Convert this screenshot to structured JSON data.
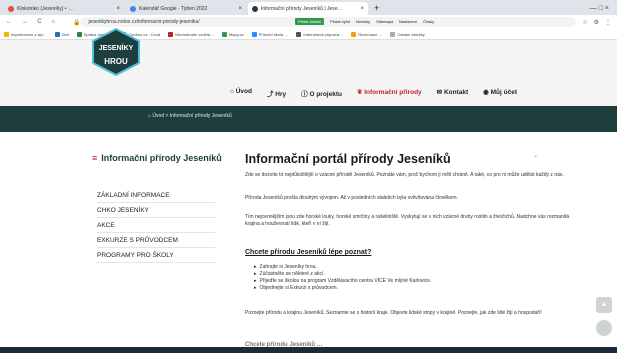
{
  "browser": {
    "tabs": [
      {
        "label": "Klokotoko (Jeseníky) • …",
        "color": "#e44f3a"
      },
      {
        "label": "Kalendář Google - Týden 2022",
        "color": "#4285f4"
      },
      {
        "label": "Informační přírody Jeseníků | Jese…",
        "color": "#1d3e3c"
      }
    ],
    "new_tab": "+",
    "window_controls": "—   □   ×",
    "nav_buttons": "← → C ⌂",
    "url": "jesenikyhrou.notoo.cz/informacni-prirody-jeseniku/",
    "bookmarks": [
      {
        "label": "Importováno z apl…",
        "color": "#f5b400"
      },
      {
        "label": "Dell",
        "color": "#2b6cb0"
      },
      {
        "label": "Správa Jeseníků",
        "color": "#3a7d44"
      },
      {
        "label": "Ozvěno.cz - Úvod",
        "color": "#888"
      },
      {
        "label": "Mezinárodní vzdělá…",
        "color": "#c0232a"
      },
      {
        "label": "Mapy.cz",
        "color": "#2e9a4a"
      },
      {
        "label": "Přírodní škola …",
        "color": "#1e90ff"
      },
      {
        "label": "Internetová příprava…",
        "color": "#555"
      },
      {
        "label": "Rezervace …",
        "color": "#f59e0b"
      },
      {
        "label": "Ostatní záložky",
        "color": "#aaa"
      }
    ]
  },
  "site": {
    "topstrip": [
      "Přidat článek",
      "Přidat výlet",
      "Novinky",
      "Sitemapa",
      "Nastavení",
      "Česky"
    ],
    "logo_top": "JESENÍKY",
    "logo_bottom": "HROU",
    "nav": [
      "Úvod",
      "Hry",
      "O projektu",
      "Informační přírody",
      "Kontakt",
      "Můj účet"
    ],
    "breadcrumb": "Úvod  >  Informační přírody Jeseníků",
    "sidebar_title": "Informační přírody Jeseníků",
    "sidebar_items": [
      "ZÁKLADNÍ INFORMACE",
      "CHKO JESENÍKY",
      "AKCE",
      "EXKURZE S PRŮVODCEM",
      "PROGRAMY PRO ŠKOLY"
    ],
    "page_title": "Informační portál přírody Jeseníků",
    "paragraphs": [
      "Zde se dozvíte to nejdůležitější o vzácné přírodě Jeseníků. Poznáte vám, proč bychom ji měli chránit. A také, co pro ni může udělat každý z nás.",
      "Příroda Jeseníků prošla dlouhým vývojem. Až v posledních staletích byla ovlivňována člověkem.",
      "Tím nejcennějším jsou zde horské louky, horské smrčiny a rašeliniště. Vyskytují se v nich vzácné druhy rostlin a živočichů. Nadchne vás rozmanitá krajina a houževnatí lidé, kteří v ní žijí.",
      "Poznejte přírodu a krajinu Jeseníků. Seznamte se s historií kraje. Objevte lidské stopy v krajině. Poznejte, jak zde lidé žijí a hospodaří!"
    ],
    "subheading": "Chcete přírodu Jeseníků lépe poznat?",
    "bullets": [
      "Zahrajte si Jeseníky hrou.",
      "Zúčastněte se některé z akcí.",
      "Přijeďte se školou na program Vzdělávacího centra VÍCE Ve mlýně Karlovice.",
      "Objednejte si Exkurzi s průvodcem."
    ],
    "next_heading": "Chcete přírodu Jeseníků …",
    "colors": {
      "accent": "#c0232a",
      "banner": "#1d3e3c",
      "button": "#2e9a4a"
    }
  }
}
